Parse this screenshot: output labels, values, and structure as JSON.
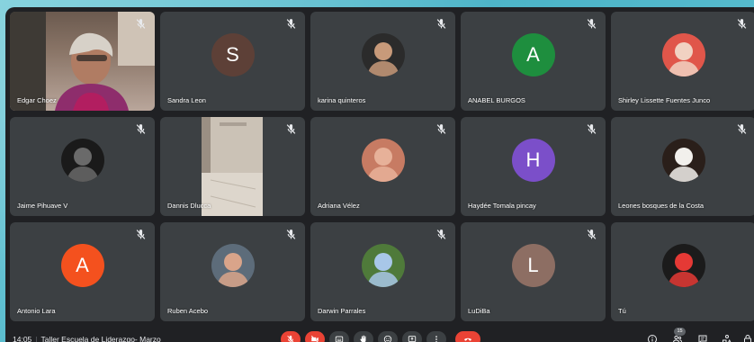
{
  "participants": [
    {
      "name": "Edgar Choez",
      "type": "video",
      "muted": true
    },
    {
      "name": "Sandra Leon",
      "type": "letter",
      "letter": "S",
      "color": "#5d4037",
      "muted": true
    },
    {
      "name": "karina quinteros",
      "type": "photo",
      "photo_colors": [
        "#2b2b2b",
        "#c89a7a"
      ],
      "muted": true
    },
    {
      "name": "ANABEL BURGOS",
      "type": "letter",
      "letter": "A",
      "color": "#1e8e3e",
      "muted": true
    },
    {
      "name": "Shirley Lissette Fuentes Junco",
      "type": "photo",
      "photo_colors": [
        "#e0564a",
        "#f1d2c2"
      ],
      "muted": true
    },
    {
      "name": "Jaime Pihuave V",
      "type": "photo",
      "photo_colors": [
        "#1a1a1a",
        "#6a6a6a"
      ],
      "muted": true
    },
    {
      "name": "Dannis Dlucca",
      "type": "video-door",
      "muted": true
    },
    {
      "name": "Adriana Vélez",
      "type": "photo",
      "photo_colors": [
        "#c77b63",
        "#e7b199"
      ],
      "muted": true
    },
    {
      "name": "Haydée Tomala pincay",
      "type": "letter",
      "letter": "H",
      "color": "#7b4fc9",
      "muted": true
    },
    {
      "name": "Leones bosques de la Costa",
      "type": "photo",
      "photo_colors": [
        "#2a1f1a",
        "#f2f0ec"
      ],
      "muted": true
    },
    {
      "name": "Antonio Lara",
      "type": "letter",
      "letter": "A",
      "color": "#f4511e",
      "muted": true
    },
    {
      "name": "Ruben Acebo",
      "type": "photo",
      "photo_colors": [
        "#5d6c7a",
        "#d9a48a"
      ],
      "muted": true
    },
    {
      "name": "Darwin Parrales",
      "type": "photo",
      "photo_colors": [
        "#4f7a3a",
        "#a8c7e8"
      ],
      "muted": true
    },
    {
      "name": "LuDiBa",
      "type": "letter",
      "letter": "L",
      "color": "#8d6e63",
      "muted": true
    },
    {
      "name": "Tú",
      "type": "photo",
      "photo_colors": [
        "#1b1b1b",
        "#e53935"
      ],
      "muted": false
    }
  ],
  "bottom_bar": {
    "time": "14:05",
    "separator": "|",
    "meeting_title": "Taller Escuela de Liderazgo- Marzo",
    "participant_count": "15"
  },
  "colors": {
    "meet_bg": "#202124",
    "tile_bg": "#3c4043",
    "danger": "#ea4335"
  },
  "icons": {
    "controls": [
      "mic-off-icon",
      "camera-off-icon",
      "captions-icon",
      "raise-hand-icon",
      "emoji-icon",
      "present-icon",
      "more-options-icon",
      "end-call-icon"
    ],
    "right": [
      "info-icon",
      "people-icon",
      "chat-icon",
      "activities-icon",
      "host-controls-icon"
    ]
  }
}
